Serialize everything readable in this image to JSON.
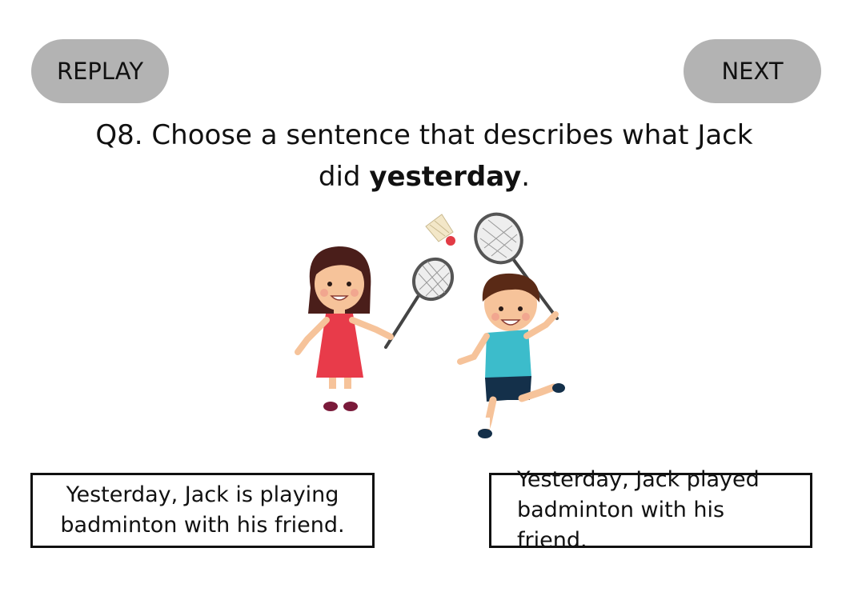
{
  "nav": {
    "replay_label": "REPLAY",
    "next_label": "NEXT",
    "button_color": "#b3b3b3"
  },
  "question": {
    "prefix": "Q8. Choose a sentence that describes what Jack",
    "line2_start": "did ",
    "emphasis": "yesterday",
    "line2_end": "."
  },
  "illustration": {
    "subject": "girl and boy playing badminton",
    "icons": [
      "girl-figure",
      "boy-figure",
      "racket-icon",
      "shuttlecock-icon"
    ]
  },
  "answers": [
    {
      "line1": "Yesterday, Jack is playing",
      "line2": "badminton with his friend."
    },
    {
      "line1": "Yesterday, Jack played",
      "line2": "badminton with his friend."
    }
  ]
}
